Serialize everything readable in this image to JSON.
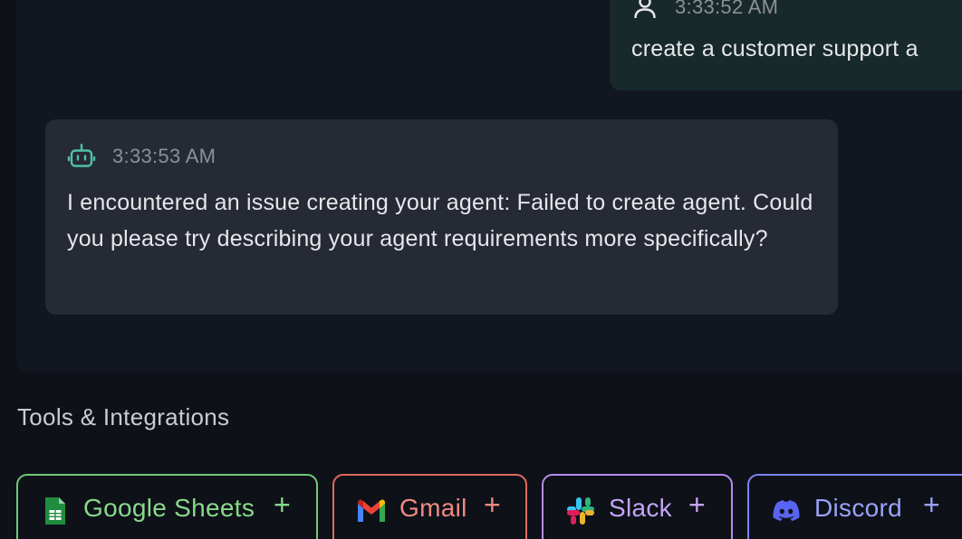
{
  "chat": {
    "user_message": {
      "timestamp": "3:33:52 AM",
      "text": "create a customer support a"
    },
    "bot_message": {
      "timestamp": "3:33:53 AM",
      "text": "I encountered an issue creating your agent: Failed to create agent. Could you please try describing your agent requirements more specifically?"
    }
  },
  "tools": {
    "section_title": "Tools & Integrations",
    "items": [
      {
        "label": "Google Sheets",
        "icon": "google-sheets-icon",
        "action": "+",
        "color": "#88d98b"
      },
      {
        "label": "Gmail",
        "icon": "gmail-icon",
        "action": "+",
        "color": "#f08a80"
      },
      {
        "label": "Slack",
        "icon": "slack-icon",
        "action": "+",
        "color": "#c4a4f7"
      },
      {
        "label": "Discord",
        "icon": "discord-icon",
        "action": "+",
        "color": "#9aa2f8"
      }
    ]
  },
  "colors": {
    "background": "#0e1118",
    "chat_panel": "#121620",
    "user_bubble": "#17292a",
    "bot_bubble": "#262a35",
    "bot_accent": "#4fc3a1"
  }
}
